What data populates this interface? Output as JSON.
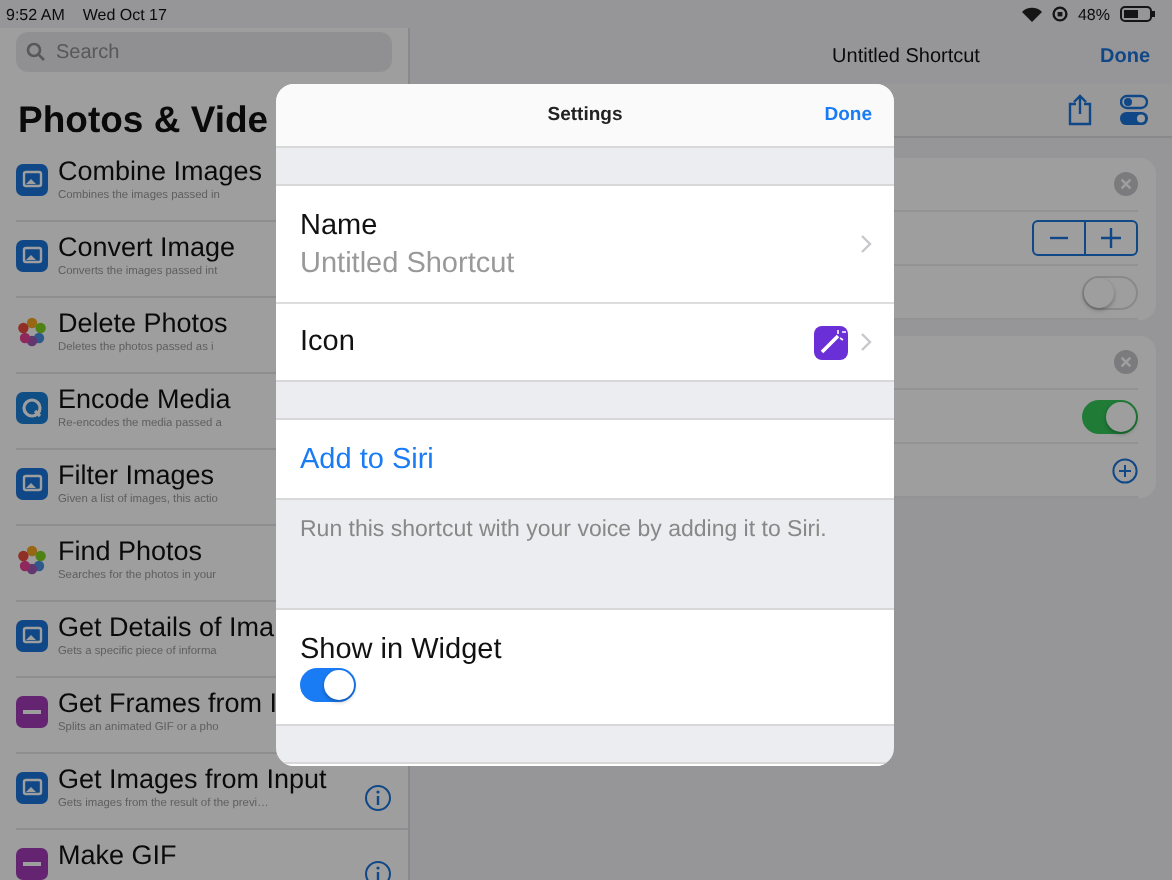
{
  "status_bar": {
    "time": "9:52 AM",
    "date": "Wed Oct 17",
    "battery": "48%"
  },
  "sidebar": {
    "search_placeholder": "Search",
    "heading": "Photos & Vide",
    "items": [
      {
        "title": "Combine Images",
        "subtitle": "Combines the images passed in",
        "kind": "image"
      },
      {
        "title": "Convert Image",
        "subtitle": "Converts the images passed int",
        "kind": "image"
      },
      {
        "title": "Delete Photos",
        "subtitle": "Deletes the photos passed as i",
        "kind": "photos"
      },
      {
        "title": "Encode Media",
        "subtitle": "Re-encodes the media passed a",
        "kind": "media"
      },
      {
        "title": "Filter Images",
        "subtitle": "Given a list of images, this actio",
        "kind": "image"
      },
      {
        "title": "Find Photos",
        "subtitle": "Searches for the photos in your",
        "kind": "photos"
      },
      {
        "title": "Get Details of Ima",
        "subtitle": "Gets a specific piece of informa",
        "kind": "image"
      },
      {
        "title": "Get Frames from I",
        "subtitle": "Splits an animated GIF or a pho",
        "kind": "gif"
      },
      {
        "title": "Get Images from Input",
        "subtitle": "Gets images from the result of the previ…",
        "kind": "image",
        "info": true
      },
      {
        "title": "Make GIF",
        "kind": "gif",
        "info": true
      }
    ]
  },
  "editor": {
    "title": "Untitled Shortcut",
    "done": "Done",
    "cards": [
      {
        "controls": [
          {
            "kind": "stepper"
          },
          {
            "kind": "toggle",
            "on": false
          }
        ]
      },
      {
        "controls": [
          {
            "kind": "toggle",
            "on": true
          },
          {
            "kind": "add"
          }
        ]
      }
    ]
  },
  "modal": {
    "title": "Settings",
    "done": "Done",
    "name_label": "Name",
    "name_value": "Untitled Shortcut",
    "icon_label": "Icon",
    "add_to_siri": "Add to Siri",
    "siri_footer": "Run this shortcut with your voice by adding it to Siri.",
    "widget_label": "Show in Widget",
    "widget_on": true
  }
}
